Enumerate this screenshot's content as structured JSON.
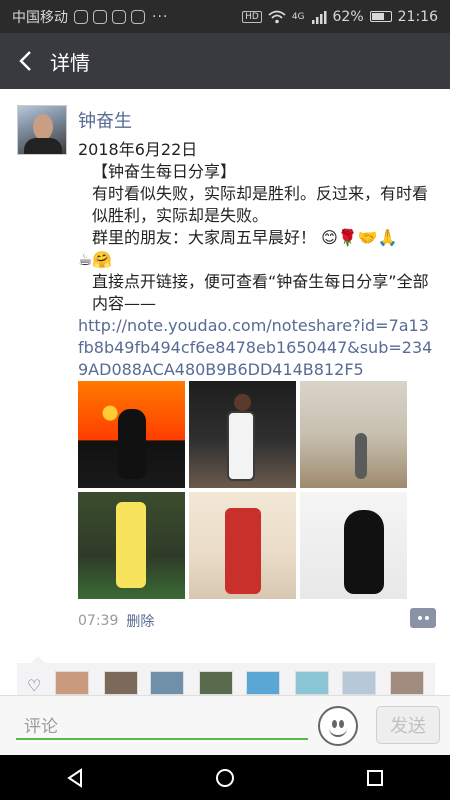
{
  "status_bar": {
    "carrier": "中国移动",
    "dots": "···",
    "hd": "HD",
    "signal": "4G",
    "battery": "62%",
    "time": "21:16"
  },
  "title_bar": {
    "title": "详情"
  },
  "post": {
    "username": "钟奋生",
    "date": "2018年6月22日",
    "heading": "【钟奋生每日分享】",
    "paragraph1": "有时看似失败，实际却是胜利。反过来，有时看似胜利，实际却是失败。",
    "greeting": "群里的朋友：大家周五早晨好！",
    "emoji_line1": "😊🌹🤝🙏",
    "emoji_line2": "☕🤗",
    "paragraph2": "直接点开链接，便可查看“钟奋生每日分享”全部内容——",
    "link": "http://note.youdao.com/noteshare?id=7a13fb8b49fb494cf6e8478eb1650447&sub=2349AD088ACA480B9B6DD414B812F5",
    "time": "07:39",
    "delete_label": "删除"
  },
  "input_bar": {
    "placeholder": "评论",
    "send_label": "发送"
  },
  "icons": {
    "back": "chevron-left-icon",
    "emoji": "smiley-icon",
    "comment": "comment-icon",
    "heart": "heart-icon"
  },
  "colors": {
    "link": "#576b95",
    "title_bar": "#393a3f",
    "status_bar": "#2b2b2b",
    "input_underline": "#58b84f"
  }
}
